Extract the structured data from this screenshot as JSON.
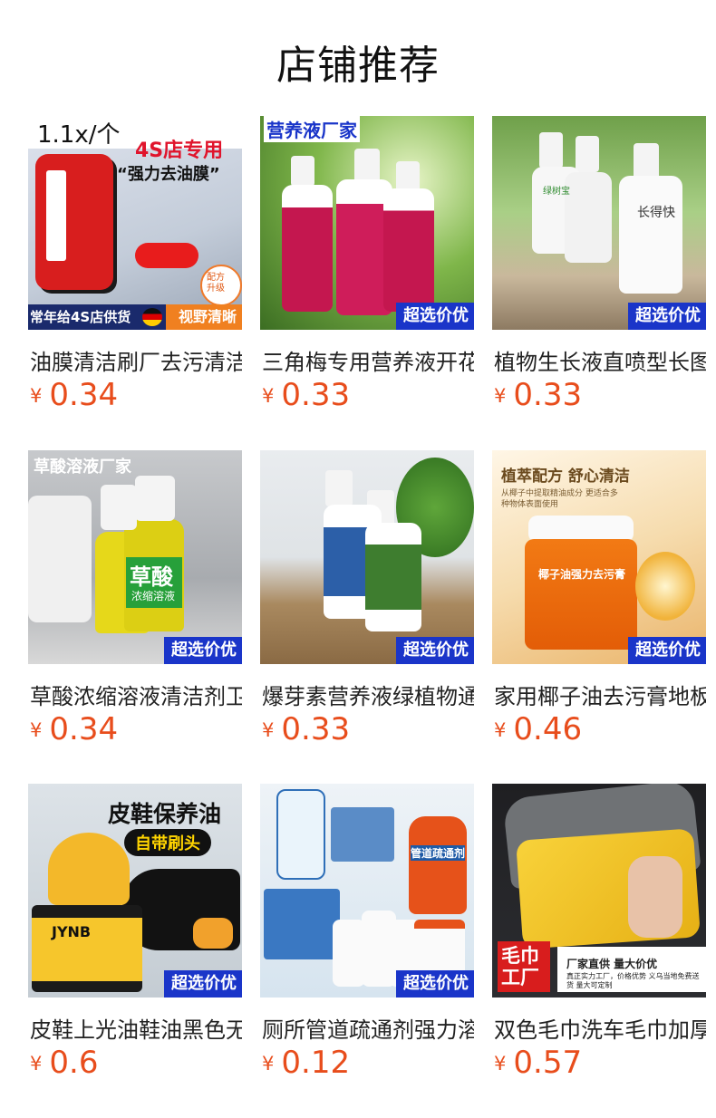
{
  "section_title": "店铺推荐",
  "currency_symbol": "¥",
  "products": [
    {
      "name": "油膜清洁刷厂去污清洁",
      "price": "0.34",
      "overlay": {
        "top": "1.1x/个",
        "brand": "4S店专用",
        "slogan": "“强力去油膜”",
        "bottom_left": "常年给4S店供货",
        "bottom_right": "视野清晰",
        "stamp": "配方升级"
      }
    },
    {
      "name": "三角梅专用营养液开花",
      "price": "0.33",
      "overlay": {
        "top": "营养液厂家"
      },
      "badge": "超选价优"
    },
    {
      "name": "植物生长液直喷型长图",
      "price": "0.33",
      "overlay": {
        "label_a": "绿树宝",
        "label_b": "长得快"
      },
      "badge": "超选价优"
    },
    {
      "name": "草酸浓缩溶液清洁剂卫",
      "price": "0.34",
      "overlay": {
        "top": "草酸溶液厂家",
        "label": "草酸",
        "sublabel": "浓缩溶液"
      },
      "badge": "超选价优"
    },
    {
      "name": "爆芽素营养液绿植物通",
      "price": "0.33",
      "overlay": {},
      "badge": "超选价优"
    },
    {
      "name": "家用椰子油去污膏地板",
      "price": "0.46",
      "overlay": {
        "top": "植萃配方 舒心清洁",
        "desc": "从椰子中提取精油成分 更适合多种物体表面使用",
        "label": "椰子油强力去污膏"
      },
      "badge": "超选价优"
    },
    {
      "name": "皮鞋上光油鞋油黑色无",
      "price": "0.6",
      "overlay": {
        "top": "皮鞋保养油",
        "pill": "自带刷头",
        "brand": "JYNB"
      },
      "badge": "超选价优"
    },
    {
      "name": "厕所管道疏通剂强力溶",
      "price": "0.12",
      "overlay": {
        "label": "管道疏通剂"
      },
      "badge": "超选价优"
    },
    {
      "name": "双色毛巾洗车毛巾加厚",
      "price": "0.57",
      "overlay": {
        "tag": "毛巾工厂",
        "line1": "厂家直供 量大价优",
        "line2": "真正实力工厂，价格优势 义乌当地免费送货 量大可定制"
      }
    }
  ]
}
